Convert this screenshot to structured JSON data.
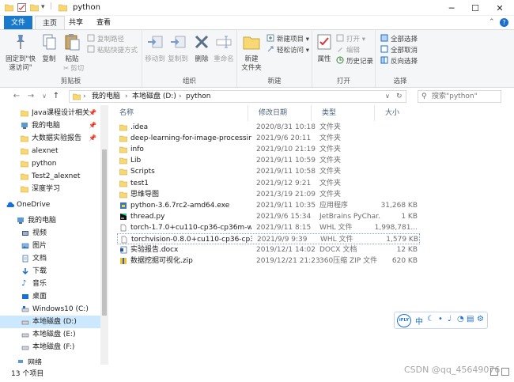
{
  "window": {
    "title": "python"
  },
  "tabs": [
    {
      "label": "文件"
    },
    {
      "label": "主页"
    },
    {
      "label": "共享"
    },
    {
      "label": "查看"
    }
  ],
  "ribbon": {
    "clipboard": {
      "pin_label": "固定到\"快速访问\"",
      "pin_l1": "固定到\"快",
      "pin_l2": "速访问\"",
      "copy": "复制",
      "paste": "粘贴",
      "copy_path": "复制路径",
      "paste_shortcut": "粘贴快捷方式",
      "cut": "剪切",
      "group": "剪贴板"
    },
    "organize": {
      "move_to": "移动到",
      "copy_to": "复制到",
      "delete": "删除",
      "rename": "重命名",
      "group": "组织"
    },
    "new": {
      "new_folder_l1": "新建",
      "new_folder_l2": "文件夹",
      "new_item": "新建项目 ▾",
      "easy_access": "轻松访问 ▾",
      "group": "新建"
    },
    "open": {
      "properties": "属性",
      "open": "打开 ▾",
      "edit": "编辑",
      "history": "历史记录",
      "group": "打开"
    },
    "select": {
      "select_all": "全部选择",
      "select_none": "全部取消",
      "invert": "反向选择",
      "group": "选择"
    }
  },
  "address": {
    "crumbs": [
      "我的电脑",
      "本地磁盘 (D:)",
      "python"
    ],
    "search_placeholder": "搜索\"python\""
  },
  "nav": {
    "items": [
      {
        "label": "Java课程设计相关资料",
        "icon": "folder-icon"
      },
      {
        "label": "我的电脑",
        "icon": "computer-icon"
      },
      {
        "label": "大数据实验报告",
        "icon": "folder-icon"
      },
      {
        "label": "alexnet",
        "icon": "folder-icon"
      },
      {
        "label": "python",
        "icon": "folder-icon"
      },
      {
        "label": "Test2_alexnet",
        "icon": "folder-icon"
      },
      {
        "label": "深度学习",
        "icon": "folder-icon"
      },
      {
        "label": "OneDrive",
        "icon": "cloud-icon"
      },
      {
        "label": "我的电脑",
        "icon": "computer-icon"
      },
      {
        "label": "视频",
        "icon": "video-icon"
      },
      {
        "label": "图片",
        "icon": "picture-icon"
      },
      {
        "label": "文档",
        "icon": "document-icon"
      },
      {
        "label": "下载",
        "icon": "download-icon"
      },
      {
        "label": "音乐",
        "icon": "music-icon"
      },
      {
        "label": "桌面",
        "icon": "desktop-icon"
      },
      {
        "label": "Windows10 (C:)",
        "icon": "drive-icon"
      },
      {
        "label": "本地磁盘 (D:)",
        "icon": "drive-icon"
      },
      {
        "label": "本地磁盘 (E:)",
        "icon": "drive-icon"
      },
      {
        "label": "本地磁盘 (F:)",
        "icon": "drive-icon"
      },
      {
        "label": "网络",
        "icon": "network-icon"
      }
    ]
  },
  "columns": {
    "name": "名称",
    "date": "修改日期",
    "type": "类型",
    "size": "大小"
  },
  "files": [
    {
      "name": ".idea",
      "date": "2020/8/31 10:18",
      "type": "文件夹",
      "size": "",
      "icon": "folder-icon"
    },
    {
      "name": "deep-learning-for-image-processing...",
      "date": "2021/9/6 20:11",
      "type": "文件夹",
      "size": "",
      "icon": "folder-icon"
    },
    {
      "name": "info",
      "date": "2021/9/10 21:19",
      "type": "文件夹",
      "size": "",
      "icon": "folder-icon"
    },
    {
      "name": "Lib",
      "date": "2021/9/11 10:59",
      "type": "文件夹",
      "size": "",
      "icon": "folder-icon"
    },
    {
      "name": "Scripts",
      "date": "2021/9/11 10:58",
      "type": "文件夹",
      "size": "",
      "icon": "folder-icon"
    },
    {
      "name": "test1",
      "date": "2021/9/12 9:21",
      "type": "文件夹",
      "size": "",
      "icon": "folder-icon"
    },
    {
      "name": "思维导图",
      "date": "2021/3/19 21:09",
      "type": "文件夹",
      "size": "",
      "icon": "folder-icon"
    },
    {
      "name": "python-3.6.7rc2-amd64.exe",
      "date": "2021/9/11 10:35",
      "type": "应用程序",
      "size": "31,268 KB",
      "icon": "exe-icon"
    },
    {
      "name": "thread.py",
      "date": "2021/9/6 15:34",
      "type": "JetBrains PyChar...",
      "size": "1 KB",
      "icon": "pycharm-icon"
    },
    {
      "name": "torch-1.7.0+cu110-cp36-cp36m-win_...",
      "date": "2021/9/11 8:15",
      "type": "WHL 文件",
      "size": "1,998,781...",
      "icon": "file-icon"
    },
    {
      "name": "torchvision-0.8.0+cu110-cp36-cp36m...",
      "date": "2021/9/9 9:39",
      "type": "WHL 文件",
      "size": "1,579 KB",
      "icon": "file-icon"
    },
    {
      "name": "实验报告.docx",
      "date": "2019/12/1 14:02",
      "type": "DOCX 文档",
      "size": "12 KB",
      "icon": "docx-icon"
    },
    {
      "name": "数据挖掘可视化.zip",
      "date": "2019/12/21 21:23",
      "type": "360压缩 ZIP 文件",
      "size": "620 KB",
      "icon": "zip-icon"
    }
  ],
  "ime": {
    "logo": "iFLY",
    "lang": "中"
  },
  "status": {
    "count": "13 个项目"
  },
  "watermark": "CSDN @qq_45649076",
  "colors": {
    "accent": "#1979ca",
    "folder": "#f8d775",
    "selection": "#cce8ff"
  }
}
